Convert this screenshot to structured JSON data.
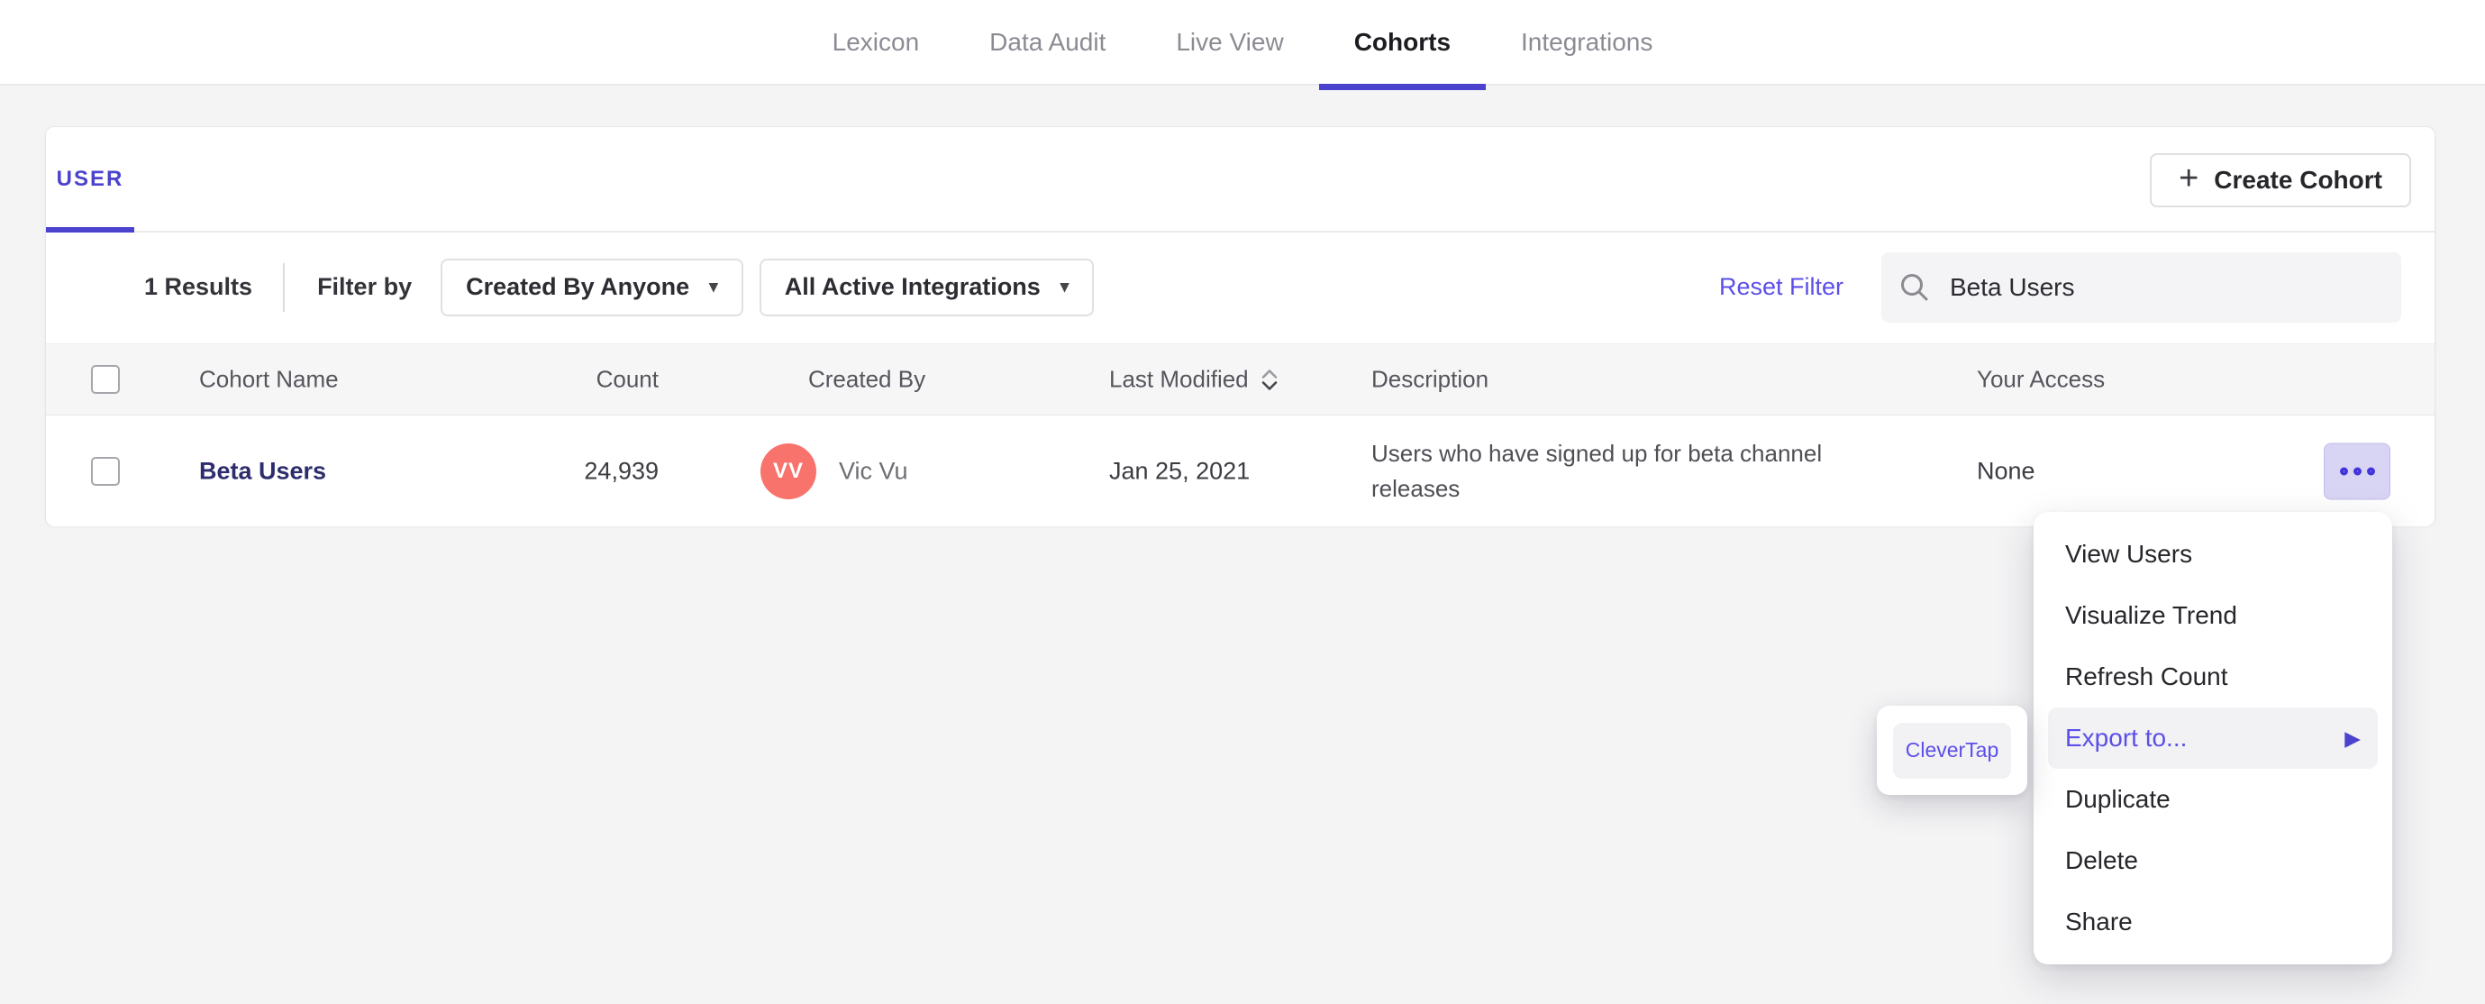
{
  "nav": {
    "tabs": [
      {
        "label": "Lexicon"
      },
      {
        "label": "Data Audit"
      },
      {
        "label": "Live View"
      },
      {
        "label": "Cohorts"
      },
      {
        "label": "Integrations"
      }
    ],
    "active_tab": "Cohorts"
  },
  "cohorts_panel": {
    "tab_label": "USER",
    "create_button": {
      "plus_icon": "+",
      "label": "Create Cohort"
    }
  },
  "filter_bar": {
    "results_count": "1 Results",
    "filter_by_label": "Filter by",
    "created_by_dropdown": "Created By Anyone",
    "integrations_dropdown": "All Active Integrations",
    "dropdown_caret_icon": "▾",
    "reset_filter": "Reset Filter",
    "search": {
      "value": "Beta Users"
    }
  },
  "table": {
    "headers": {
      "cohort_name": "Cohort Name",
      "count": "Count",
      "created_by": "Created By",
      "last_modified": "Last Modified",
      "description": "Description",
      "your_access": "Your Access"
    },
    "row": {
      "cohort_name": "Beta Users",
      "count": "24,939",
      "creator_initials": "VV",
      "creator_name": "Vic Vu",
      "last_modified": "Jan 25, 2021",
      "description": "Users who have signed up for beta channel releases",
      "your_access": "None"
    }
  },
  "context_menu": {
    "items": [
      {
        "label": "View Users"
      },
      {
        "label": "Visualize Trend"
      },
      {
        "label": "Refresh Count"
      },
      {
        "label": "Export to...",
        "submenu_arrow_icon": "▶",
        "highlighted": true
      },
      {
        "label": "Duplicate"
      },
      {
        "label": "Delete"
      },
      {
        "label": "Share"
      }
    ]
  },
  "export_submenu": {
    "items": [
      {
        "label": "CleverTap"
      }
    ]
  },
  "colors": {
    "accent": "#4b42ce",
    "link_purple": "#5b4fe9",
    "avatar_bg": "#f8736c",
    "more_button_bg": "#d8d5f4",
    "more_button_dots": "#4334d9",
    "page_bg": "#f4f4f5",
    "header_row_bg": "#f6f6f7",
    "highlight_bg": "#f2f2f4"
  }
}
